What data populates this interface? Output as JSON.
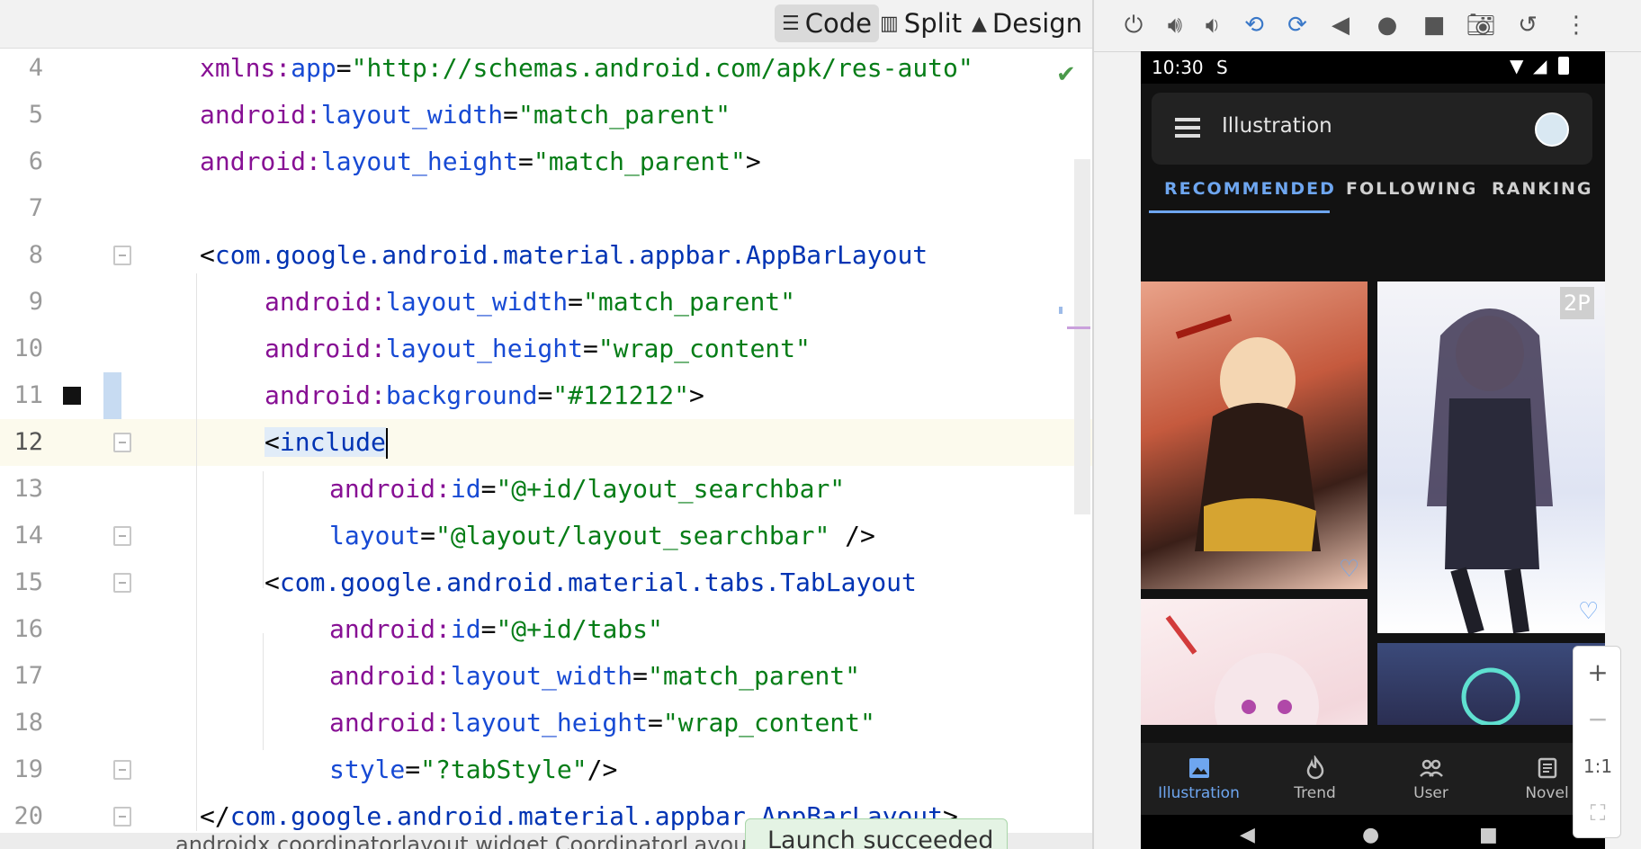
{
  "view_modes": {
    "code": "Code",
    "split": "Split",
    "design": "Design",
    "active": "code"
  },
  "editor": {
    "lines": [
      {
        "n": "4",
        "tokens": [
          [
            "ns",
            "xmlns:"
          ],
          [
            "attr",
            "app"
          ],
          [
            "plain",
            "="
          ],
          [
            "val",
            "\"http://schemas.android.com/apk/res-auto\""
          ]
        ]
      },
      {
        "n": "5",
        "tokens": [
          [
            "ns",
            "android:"
          ],
          [
            "attr",
            "layout_width"
          ],
          [
            "plain",
            "="
          ],
          [
            "val",
            "\"match_parent\""
          ]
        ]
      },
      {
        "n": "6",
        "tokens": [
          [
            "ns",
            "android:"
          ],
          [
            "attr",
            "layout_height"
          ],
          [
            "plain",
            "="
          ],
          [
            "val",
            "\"match_parent\""
          ],
          [
            "plain",
            ">"
          ]
        ]
      },
      {
        "n": "7",
        "tokens": []
      },
      {
        "n": "8",
        "tokens": [
          [
            "plain",
            "<"
          ],
          [
            "tag",
            "com.google.android.material.appbar.AppBarLayout"
          ]
        ]
      },
      {
        "n": "9",
        "tokens": [
          [
            "ns",
            "android:"
          ],
          [
            "attr",
            "layout_width"
          ],
          [
            "plain",
            "="
          ],
          [
            "val",
            "\"match_parent\""
          ]
        ]
      },
      {
        "n": "10",
        "tokens": [
          [
            "ns",
            "android:"
          ],
          [
            "attr",
            "layout_height"
          ],
          [
            "plain",
            "="
          ],
          [
            "val",
            "\"wrap_content\""
          ]
        ]
      },
      {
        "n": "11",
        "tokens": [
          [
            "ns",
            "android:"
          ],
          [
            "attr",
            "background"
          ],
          [
            "plain",
            "="
          ],
          [
            "val",
            "\"#121212\""
          ],
          [
            "plain",
            ">"
          ]
        ]
      },
      {
        "n": "12",
        "tokens": [
          [
            "plain",
            "<"
          ],
          [
            "tag",
            "include"
          ]
        ]
      },
      {
        "n": "13",
        "tokens": [
          [
            "ns",
            "android:"
          ],
          [
            "attr",
            "id"
          ],
          [
            "plain",
            "="
          ],
          [
            "val",
            "\"@+id/layout_searchbar\""
          ]
        ]
      },
      {
        "n": "14",
        "tokens": [
          [
            "attr",
            "layout"
          ],
          [
            "plain",
            "="
          ],
          [
            "val",
            "\"@layout/layout_searchbar\""
          ],
          [
            "plain",
            " />"
          ]
        ]
      },
      {
        "n": "15",
        "tokens": [
          [
            "plain",
            "<"
          ],
          [
            "tag",
            "com.google.android.material.tabs.TabLayout"
          ]
        ]
      },
      {
        "n": "16",
        "tokens": [
          [
            "ns",
            "android:"
          ],
          [
            "attr",
            "id"
          ],
          [
            "plain",
            "="
          ],
          [
            "val",
            "\"@+id/tabs\""
          ]
        ]
      },
      {
        "n": "17",
        "tokens": [
          [
            "ns",
            "android:"
          ],
          [
            "attr",
            "layout_width"
          ],
          [
            "plain",
            "="
          ],
          [
            "val",
            "\"match_parent\""
          ]
        ]
      },
      {
        "n": "18",
        "tokens": [
          [
            "ns",
            "android:"
          ],
          [
            "attr",
            "layout_height"
          ],
          [
            "plain",
            "="
          ],
          [
            "val",
            "\"wrap_content\""
          ]
        ]
      },
      {
        "n": "19",
        "tokens": [
          [
            "attr",
            "style"
          ],
          [
            "plain",
            "="
          ],
          [
            "val",
            "\"?tabStyle\""
          ],
          [
            "plain",
            "/>"
          ]
        ]
      },
      {
        "n": "20",
        "tokens": [
          [
            "plain",
            "</"
          ],
          [
            "tag",
            "com.google.android.material.appbar.AppBarLayout"
          ],
          [
            "plain",
            ">"
          ]
        ]
      }
    ],
    "current_line": "12",
    "status_text": "androidx.coordinatorlayout.widget.CoordinatorLayout",
    "toast": "Launch succeeded"
  },
  "device": {
    "status_time": "10:30",
    "status_extra": "S",
    "searchbar_title": "Illustration",
    "tabs": [
      "RECOMMENDED",
      "FOLLOWING",
      "RANKING"
    ],
    "active_tab": "RECOMMENDED",
    "badge_2p": "2P",
    "bottom_nav": [
      {
        "label": "Illustration",
        "icon": "image-icon",
        "active": true
      },
      {
        "label": "Trend",
        "icon": "flame-icon",
        "active": false
      },
      {
        "label": "User",
        "icon": "users-icon",
        "active": false
      },
      {
        "label": "Novel",
        "icon": "book-icon",
        "active": false
      }
    ],
    "accent": "#6ea6f0"
  },
  "zoom_controls": {
    "zoom_in": "+",
    "zoom_out": "−",
    "one_to_one": "1:1"
  },
  "colors": {
    "background_swatch": "#121212",
    "ok_check": "#4a9a4a"
  }
}
